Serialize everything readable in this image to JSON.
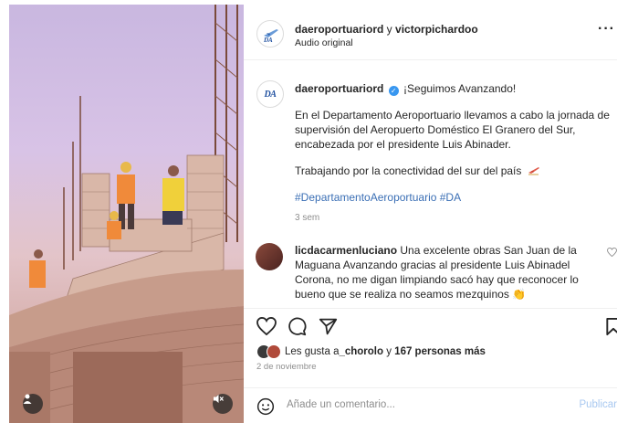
{
  "header": {
    "author": "daeroportuariord",
    "joiner": " y ",
    "collaborator": "victorpichardoo",
    "audio": "Audio original",
    "more_icon": "more-horizontal-icon"
  },
  "post": {
    "username": "daeroportuariord",
    "headline": "¡Seguimos Avanzando!",
    "paragraph1": "En el Departamento Aeroportuario llevamos a cabo la jornada de supervisión del Aeropuerto Doméstico El Granero del Sur, encabezada por el presidente Luis Abinader.",
    "paragraph2": "Trabajando por la conectividad del sur del país",
    "hashtags": "#DepartamentoAeroportuario #DA",
    "time": "3 sem",
    "logo_text": "DA"
  },
  "comment": {
    "username": "licdacarmenluciano",
    "text": "Una excelente obras San Juan de la Maguana Avanzando gracias al presidente Luis Abinadel Corona, no me digan limpiando sacó hay que reconocer lo bueno que se realiza no seamos mezquinos"
  },
  "likes": {
    "prefix": "Les gusta a ",
    "user": "_chorolo",
    "middle": " y ",
    "count": "167 personas más"
  },
  "date": "2 de noviembre",
  "composer": {
    "placeholder": "Añade un comentario...",
    "publish": "Publicar"
  },
  "colors": {
    "accent": "#0095f6",
    "link": "#3b6fb5",
    "verified": "#3897f0",
    "brand": "#1e4f9f"
  }
}
